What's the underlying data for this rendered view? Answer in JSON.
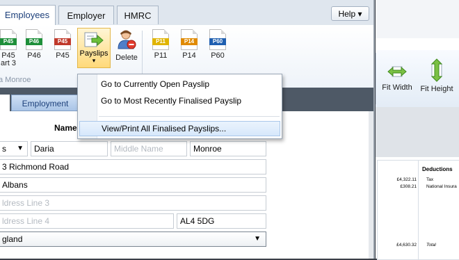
{
  "top_tabs": [
    {
      "label": "Employees",
      "active": true
    },
    {
      "label": "Employer",
      "active": false
    },
    {
      "label": "HMRC",
      "active": false
    }
  ],
  "help_label": "Help ▾",
  "ribbon": {
    "buttons": [
      {
        "label": "P45",
        "sublabel": "art 3",
        "tag": "P45",
        "color": "#1e8f3a"
      },
      {
        "label": "P46",
        "tag": "P46",
        "color": "#1e8f3a"
      },
      {
        "label": "P45",
        "tag": "P45",
        "color": "#c0392b"
      },
      {
        "label": "Payslips",
        "arrow": "▾"
      },
      {
        "label": "Delete"
      },
      {
        "label": "P11",
        "tag": "P11",
        "color": "#e0b400"
      },
      {
        "label": "P14",
        "tag": "P14",
        "color": "#e08a00"
      },
      {
        "label": "P60",
        "tag": "P60",
        "color": "#1f5fb0"
      }
    ],
    "group_label": "a Monroe"
  },
  "subtabs": [
    {
      "label": ""
    },
    {
      "label": "Employment"
    }
  ],
  "form": {
    "name_label": "Name",
    "title_value": "s",
    "first_name": "Daria",
    "middle_name_placeholder": "Middle Name",
    "last_name": "Monroe",
    "address1": "3 Richmond Road",
    "address2": "Albans",
    "address3_placeholder": "ldress Line 3",
    "address4_placeholder": "ldress Line 4",
    "postcode": "AL4 5DG",
    "country": "gland"
  },
  "payslips_menu": {
    "items": [
      "Go to Currently Open Payslip",
      "Go to Most Recently Finalised Payslip",
      "View/Print All Finalised Payslips..."
    ]
  },
  "background_window": {
    "fit_width_label": "Fit Width",
    "fit_height_label": "Fit Height",
    "deductions_header": "Deductions",
    "amounts": [
      "£4,322.11",
      "£308.21",
      "£4,630.32"
    ],
    "deductions": [
      "Tax",
      "National Insura"
    ],
    "total_label": "Total"
  },
  "colors": {
    "accent": "#1c3f7a",
    "highlight": "#d7e8fb",
    "payslips_button": "#ffd97a"
  }
}
